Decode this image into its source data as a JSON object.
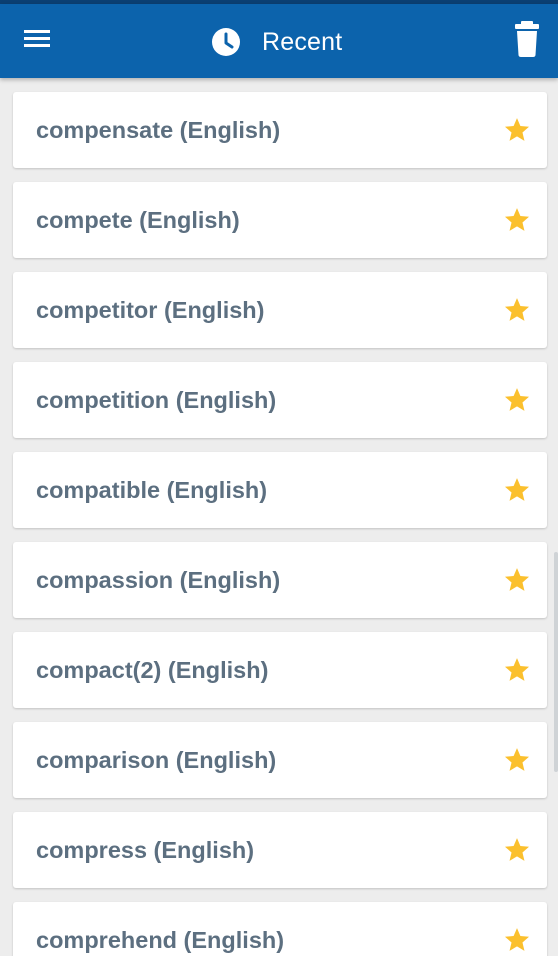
{
  "appbar": {
    "title": "Recent",
    "menu_icon": "hamburger-menu-icon",
    "title_icon": "clock-icon",
    "action_icon": "trash-icon"
  },
  "colors": {
    "appbar": "#0c63ac",
    "status_strip": "#0b3f72",
    "background": "#ededed",
    "card": "#ffffff",
    "label_text": "#5c6f80",
    "star": "#fbc02d"
  },
  "recent": {
    "items": [
      {
        "label": "compensate (English)",
        "starred": true
      },
      {
        "label": "compete (English)",
        "starred": true
      },
      {
        "label": "competitor (English)",
        "starred": true
      },
      {
        "label": "competition (English)",
        "starred": true
      },
      {
        "label": "compatible (English)",
        "starred": true
      },
      {
        "label": "compassion (English)",
        "starred": true
      },
      {
        "label": "compact(2) (English)",
        "starred": true
      },
      {
        "label": "comparison (English)",
        "starred": true
      },
      {
        "label": "compress (English)",
        "starred": true
      },
      {
        "label": "comprehend (English)",
        "starred": true
      }
    ]
  }
}
